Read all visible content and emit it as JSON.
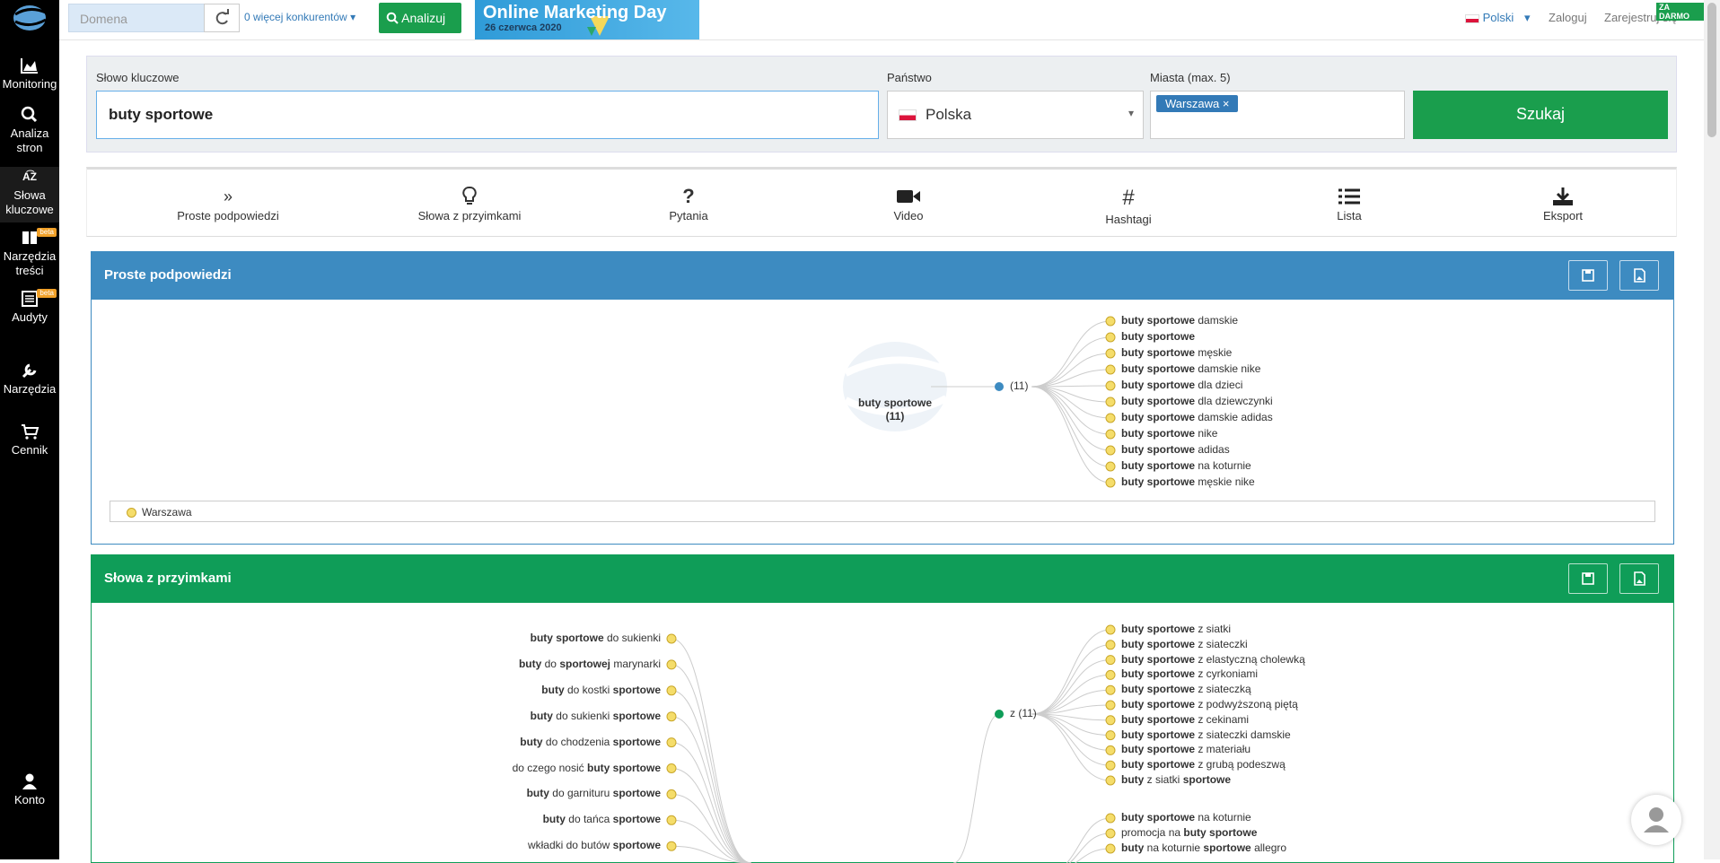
{
  "sidebar": {
    "items": [
      {
        "label": "Monitoring",
        "icon": "area-chart-icon"
      },
      {
        "label": "Analiza stron",
        "icon": "search-icon"
      },
      {
        "label": "Słowa kluczowe",
        "icon": "sort-alpha-icon"
      },
      {
        "label": "Narzędzia treści",
        "icon": "book-icon",
        "badge": "beta"
      },
      {
        "label": "Audyty",
        "icon": "list-alt-icon",
        "badge": "beta"
      },
      {
        "label": "Narzędzia",
        "icon": "wrench-icon"
      },
      {
        "label": "Cennik",
        "icon": "cart-icon"
      },
      {
        "label": "Konto",
        "icon": "user-icon"
      }
    ]
  },
  "topbar": {
    "domain_placeholder": "Domena",
    "competitors": "0 więcej konkurentów",
    "analyze": "Analizuj",
    "banner_title": "Online Marketing Day",
    "banner_date": "26 czerwca 2020",
    "language": "Polski",
    "login": "Zaloguj",
    "register": "Zarejestruj się",
    "free_badge": "ZA DARMO"
  },
  "search": {
    "keyword_label": "Słowo kluczowe",
    "keyword": "buty sportowe",
    "country_label": "Państwo",
    "country": "Polska",
    "cities_label": "Miasta (max. 5)",
    "city_tag": "Warszawa",
    "submit": "Szukaj"
  },
  "tabs": [
    "Proste podpowiedzi",
    "Słowa z przyimkami",
    "Pytania",
    "Video",
    "Hashtagi",
    "Lista",
    "Eksport"
  ],
  "panel1": {
    "title": "Proste podpowiedzi",
    "root": "buty sportowe",
    "root_count": "(11)",
    "hub": "(11)",
    "legend": "Warszawa",
    "leaves": [
      [
        "buty sportowe",
        " damskie"
      ],
      [
        "buty sportowe",
        ""
      ],
      [
        "buty sportowe",
        " męskie"
      ],
      [
        "buty sportowe",
        " damskie nike"
      ],
      [
        "buty sportowe",
        " dla dzieci"
      ],
      [
        "buty sportowe",
        " dla dziewczynki"
      ],
      [
        "buty sportowe",
        " damskie adidas"
      ],
      [
        "buty sportowe",
        " nike"
      ],
      [
        "buty sportowe",
        " adidas"
      ],
      [
        "buty sportowe",
        " na koturnie"
      ],
      [
        "buty sportowe",
        " męskie nike"
      ]
    ]
  },
  "panel2": {
    "title": "Słowa z przyimkami",
    "hub": "z (11)",
    "left": [
      [
        [
          "b",
          "buty sportowe"
        ],
        [
          "n",
          " do sukienki"
        ]
      ],
      [
        [
          "b",
          "buty"
        ],
        [
          "n",
          " do "
        ],
        [
          "b",
          "sportowej"
        ],
        [
          "n",
          " marynarki"
        ]
      ],
      [
        [
          "b",
          "buty"
        ],
        [
          "n",
          " do kostki "
        ],
        [
          "b",
          "sportowe"
        ]
      ],
      [
        [
          "b",
          "buty"
        ],
        [
          "n",
          " do sukienki "
        ],
        [
          "b",
          "sportowe"
        ]
      ],
      [
        [
          "b",
          "buty"
        ],
        [
          "n",
          " do chodzenia "
        ],
        [
          "b",
          "sportowe"
        ]
      ],
      [
        [
          "n",
          "do czego nosić "
        ],
        [
          "b",
          "buty sportowe"
        ]
      ],
      [
        [
          "b",
          "buty"
        ],
        [
          "n",
          " do garnituru "
        ],
        [
          "b",
          "sportowe"
        ]
      ],
      [
        [
          "b",
          "buty"
        ],
        [
          "n",
          " do tańca "
        ],
        [
          "b",
          "sportowe"
        ]
      ],
      [
        [
          "n",
          "wkładki do butów "
        ],
        [
          "b",
          "sportowe"
        ]
      ]
    ],
    "right": [
      [
        [
          "b",
          "buty sportowe"
        ],
        [
          "n",
          " z siatki"
        ]
      ],
      [
        [
          "b",
          "buty sportowe"
        ],
        [
          "n",
          " z siateczki"
        ]
      ],
      [
        [
          "b",
          "buty sportowe"
        ],
        [
          "n",
          " z elastyczną cholewką"
        ]
      ],
      [
        [
          "b",
          "buty sportowe"
        ],
        [
          "n",
          " z cyrkoniami"
        ]
      ],
      [
        [
          "b",
          "buty sportowe"
        ],
        [
          "n",
          " z siateczką"
        ]
      ],
      [
        [
          "b",
          "buty sportowe"
        ],
        [
          "n",
          " z podwyższoną piętą"
        ]
      ],
      [
        [
          "b",
          "buty sportowe"
        ],
        [
          "n",
          " z cekinami"
        ]
      ],
      [
        [
          "b",
          "buty sportowe"
        ],
        [
          "n",
          " z siateczki damskie"
        ]
      ],
      [
        [
          "b",
          "buty sportowe"
        ],
        [
          "n",
          " z materiału"
        ]
      ],
      [
        [
          "b",
          "buty sportowe"
        ],
        [
          "n",
          " z grubą podeszwą"
        ]
      ],
      [
        [
          "b",
          "buty"
        ],
        [
          "n",
          " z siatki "
        ],
        [
          "b",
          "sportowe"
        ]
      ]
    ],
    "right2": [
      [
        [
          "b",
          "buty sportowe"
        ],
        [
          "n",
          " na koturnie"
        ]
      ],
      [
        [
          "n",
          "promocja na "
        ],
        [
          "b",
          "buty sportowe"
        ]
      ],
      [
        [
          "b",
          "buty"
        ],
        [
          "n",
          " na koturnie "
        ],
        [
          "b",
          "sportowe"
        ],
        [
          "n",
          " allegro"
        ]
      ]
    ]
  },
  "colors": {
    "panel1": "#3d8bc1",
    "panel2": "#0f9d58",
    "green": "#1a9e4d"
  }
}
